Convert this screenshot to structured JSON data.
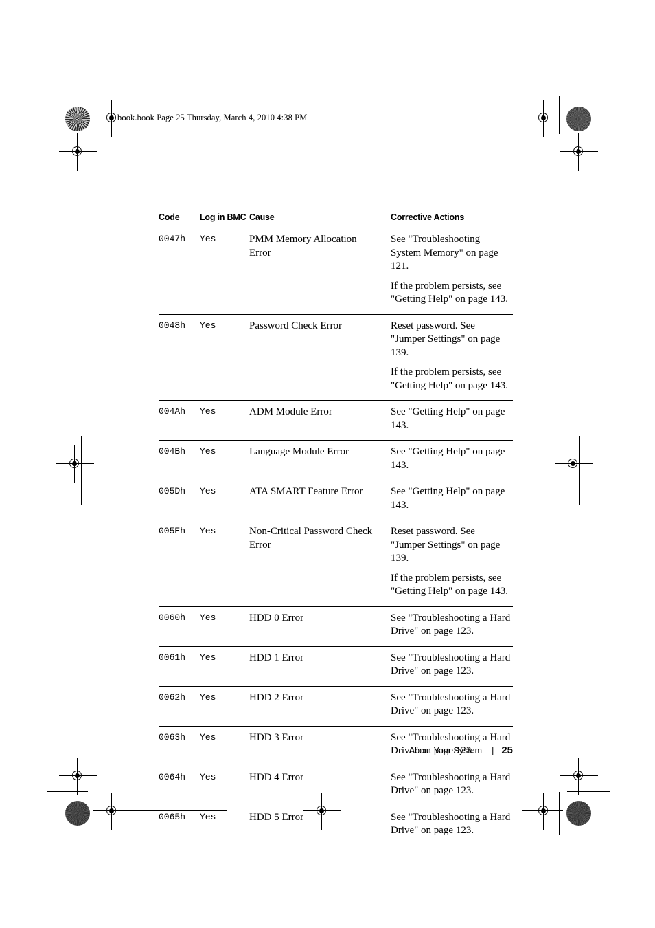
{
  "page": {
    "file_header": "book.book  Page 25  Thursday, March 4, 2010  4:38 PM",
    "footer": {
      "chapter": "About Your System",
      "separator": "|",
      "page_number": "25"
    }
  },
  "table": {
    "headers": {
      "code": "Code",
      "log_in_bmc": "Log in BMC",
      "cause": "Cause",
      "corrective_actions": "Corrective Actions"
    },
    "rows": [
      {
        "code": "0047h",
        "log_in_bmc": "Yes",
        "cause": "PMM Memory Allocation Error",
        "actions": [
          "See \"Troubleshooting System Memory\" on page 121.",
          "If the problem persists, see \"Getting Help\" on page 143."
        ]
      },
      {
        "code": "0048h",
        "log_in_bmc": "Yes",
        "cause": "Password Check Error",
        "actions": [
          "Reset password. See \"Jumper Settings\" on page 139.",
          "If the problem persists, see \"Getting Help\" on page 143."
        ]
      },
      {
        "code": "004Ah",
        "log_in_bmc": "Yes",
        "cause": "ADM Module Error",
        "actions": [
          "See \"Getting Help\" on page 143."
        ]
      },
      {
        "code": "004Bh",
        "log_in_bmc": "Yes",
        "cause": "Language Module Error",
        "actions": [
          "See \"Getting Help\" on page 143."
        ]
      },
      {
        "code": "005Dh",
        "log_in_bmc": "Yes",
        "cause": "ATA SMART Feature Error",
        "actions": [
          "See \"Getting Help\" on page 143."
        ]
      },
      {
        "code": "005Eh",
        "log_in_bmc": "Yes",
        "cause": "Non-Critical Password Check Error",
        "actions": [
          "Reset password. See \"Jumper Settings\" on page 139.",
          "If the problem persists, see \"Getting Help\" on page 143."
        ]
      },
      {
        "code": "0060h",
        "log_in_bmc": "Yes",
        "cause": "HDD 0 Error",
        "actions": [
          "See \"Troubleshooting a Hard Drive\" on page 123."
        ]
      },
      {
        "code": "0061h",
        "log_in_bmc": "Yes",
        "cause": "HDD 1 Error",
        "actions": [
          "See \"Troubleshooting a Hard Drive\" on page 123."
        ]
      },
      {
        "code": "0062h",
        "log_in_bmc": "Yes",
        "cause": "HDD 2 Error",
        "actions": [
          "See \"Troubleshooting a Hard Drive\" on page 123."
        ]
      },
      {
        "code": "0063h",
        "log_in_bmc": "Yes",
        "cause": "HDD 3 Error",
        "actions": [
          "See \"Troubleshooting a Hard Drive\" on page 123."
        ]
      },
      {
        "code": "0064h",
        "log_in_bmc": "Yes",
        "cause": "HDD 4 Error",
        "actions": [
          "See \"Troubleshooting a Hard Drive\" on page 123."
        ]
      },
      {
        "code": "0065h",
        "log_in_bmc": "Yes",
        "cause": "HDD 5 Error",
        "actions": [
          "See \"Troubleshooting a Hard Drive\" on page 123."
        ]
      }
    ]
  }
}
